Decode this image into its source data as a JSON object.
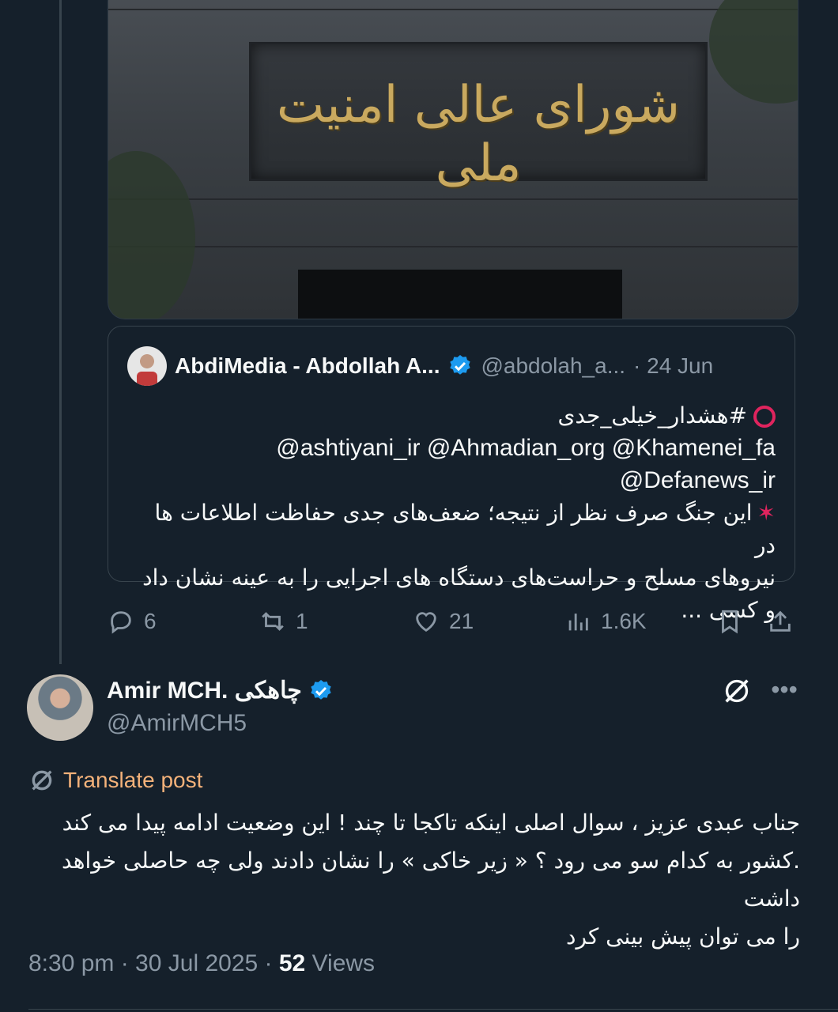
{
  "media": {
    "sign_text": "شورای عالی امنیت ملی"
  },
  "quoted_post": {
    "author_name": "AbdiMedia - Abdollah A...",
    "author_handle": "@abdolah_a...",
    "date": "· 24 Jun",
    "hashtag_line": "#هشدار_خیلی_جدی",
    "mentions_line1": "@ashtiyani_ir @Ahmadian_org @Khamenei_fa",
    "mentions_line2": "@Defanews_ir",
    "text_line1": "این جنگ صرف نظر از نتیجه؛ ضعف‌های جدی حفاظت اطلاعات ها در",
    "text_line2": "نیروهای مسلح و حراست‌های دستگاه های اجرایی را به عینه نشان داد و کسی ..."
  },
  "actions": {
    "replies": "6",
    "reposts": "1",
    "likes": "21",
    "views": "1.6K"
  },
  "reply": {
    "author_name": "Amir MCH. چاهکی",
    "author_handle": "@AmirMCH5",
    "translate_label": "Translate post",
    "line1": "جناب عبدی عزیز  ، سوال اصلی  اینکه تاکجا تا چند ! این وضعیت ادامه پیدا می کند",
    "line2": ".کشور به کدام  سو می رود ؟ « زیر خاکی » را نشان دادند ولی چه حاصلی خواهد داشت",
    "line3": "را می توان پیش بینی کرد",
    "time_date": "8:30 pm · 30 Jul 2025 · ",
    "views_count": "52",
    "views_label": " Views"
  },
  "colors": {
    "background": "#15202b",
    "secondary_text": "#8b98a5",
    "verified_blue": "#1d9bf0",
    "translate_orange": "#f4b27a"
  }
}
